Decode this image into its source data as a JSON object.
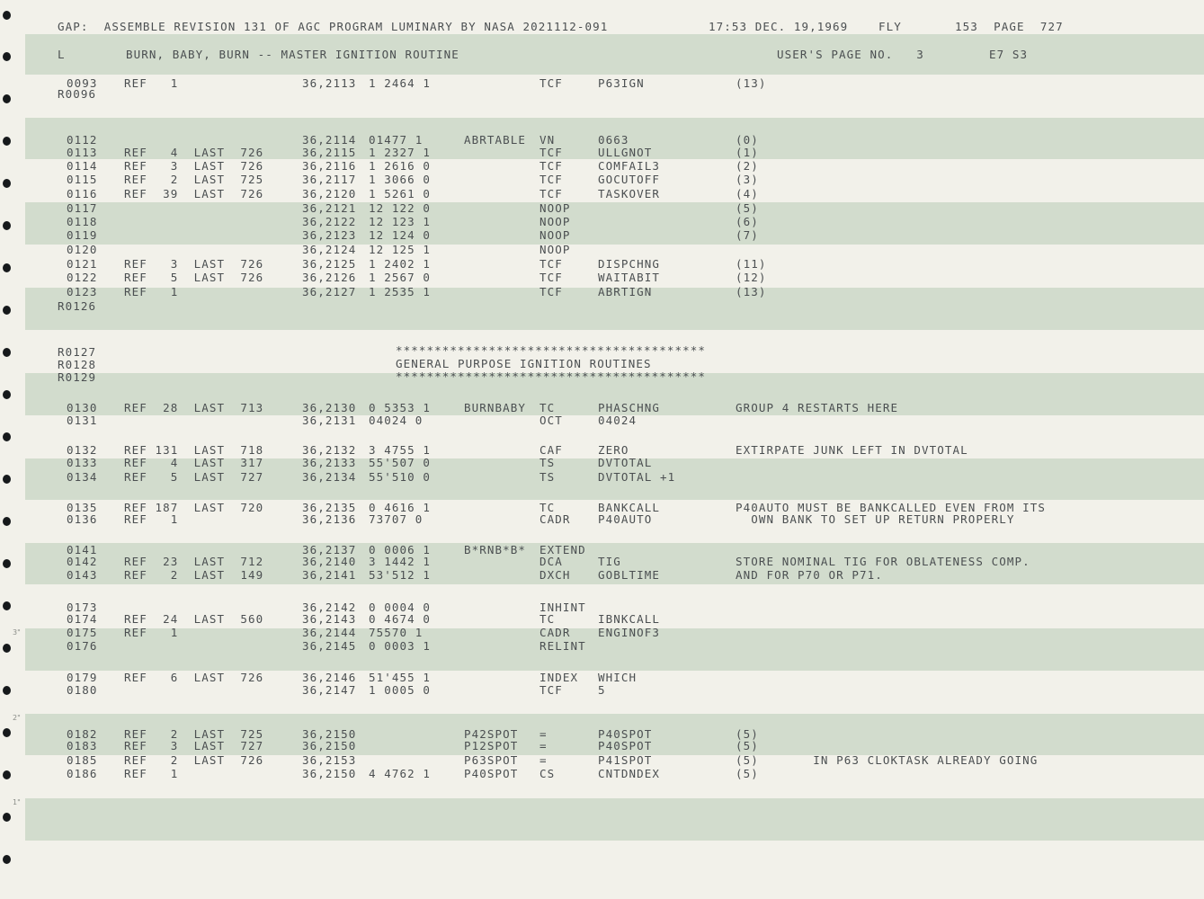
{
  "header": {
    "title": "GAP:  ASSEMBLE REVISION 131 OF AGC PROGRAM LUMINARY BY NASA 2021112-091",
    "timestamp": "17:53 DEC. 19,1969",
    "fly": "FLY",
    "page_info": "153  PAGE  727",
    "log_letter": "L",
    "routine_title": "BURN, BABY, BURN -- MASTER IGNITION ROUTINE",
    "user_page": "USER'S PAGE NO.   3",
    "code": "E7 S3"
  },
  "banner": {
    "stars": "****************************************",
    "title": "GENERAL PURPOSE IGNITION ROUTINES"
  },
  "margin_marks": [
    "3\"",
    "2\"",
    "1\""
  ],
  "listing": [
    {
      "seq": "0093",
      "ref": "REF   1",
      "addr": "36,2113",
      "word": "1 2464 1",
      "label": "",
      "op": "TCF",
      "operand": "P63IGN",
      "comment": "(13)"
    },
    {
      "seq": "R0096",
      "ref": "",
      "addr": "",
      "word": "",
      "label": "",
      "op": "",
      "operand": "",
      "comment": ""
    },
    {
      "seq": "0112",
      "ref": "",
      "addr": "36,2114",
      "word": "01477 1",
      "label": "ABRTABLE",
      "op": "VN",
      "operand": "0663",
      "comment": "(0)"
    },
    {
      "seq": "0113",
      "ref": "REF   4  LAST  726",
      "addr": "36,2115",
      "word": "1 2327 1",
      "label": "",
      "op": "TCF",
      "operand": "ULLGNOT",
      "comment": "(1)"
    },
    {
      "seq": "0114",
      "ref": "REF   3  LAST  726",
      "addr": "36,2116",
      "word": "1 2616 0",
      "label": "",
      "op": "TCF",
      "operand": "COMFAIL3",
      "comment": "(2)"
    },
    {
      "seq": "0115",
      "ref": "REF   2  LAST  725",
      "addr": "36,2117",
      "word": "1 3066 0",
      "label": "",
      "op": "TCF",
      "operand": "GOCUTOFF",
      "comment": "(3)"
    },
    {
      "seq": "0116",
      "ref": "REF  39  LAST  726",
      "addr": "36,2120",
      "word": "1 5261 0",
      "label": "",
      "op": "TCF",
      "operand": "TASKOVER",
      "comment": "(4)"
    },
    {
      "seq": "0117",
      "ref": "",
      "addr": "36,2121",
      "word": "12 122 0",
      "label": "",
      "op": "NOOP",
      "operand": "",
      "comment": "(5)"
    },
    {
      "seq": "0118",
      "ref": "",
      "addr": "36,2122",
      "word": "12 123 1",
      "label": "",
      "op": "NOOP",
      "operand": "",
      "comment": "(6)"
    },
    {
      "seq": "0119",
      "ref": "",
      "addr": "36,2123",
      "word": "12 124 0",
      "label": "",
      "op": "NOOP",
      "operand": "",
      "comment": "(7)"
    },
    {
      "seq": "0120",
      "ref": "",
      "addr": "36,2124",
      "word": "12 125 1",
      "label": "",
      "op": "NOOP",
      "operand": "",
      "comment": ""
    },
    {
      "seq": "0121",
      "ref": "REF   3  LAST  726",
      "addr": "36,2125",
      "word": "1 2402 1",
      "label": "",
      "op": "TCF",
      "operand": "DISPCHNG",
      "comment": "(11)"
    },
    {
      "seq": "0122",
      "ref": "REF   5  LAST  726",
      "addr": "36,2126",
      "word": "1 2567 0",
      "label": "",
      "op": "TCF",
      "operand": "WAITABIT",
      "comment": "(12)"
    },
    {
      "seq": "0123",
      "ref": "REF   1",
      "addr": "36,2127",
      "word": "1 2535 1",
      "label": "",
      "op": "TCF",
      "operand": "ABRTIGN",
      "comment": "(13)"
    },
    {
      "seq": "R0126",
      "ref": "",
      "addr": "",
      "word": "",
      "label": "",
      "op": "",
      "operand": "",
      "comment": ""
    },
    {
      "seq": "R0127",
      "ref": "",
      "addr": "",
      "word": "",
      "label": "",
      "op": "",
      "operand": "",
      "comment": ""
    },
    {
      "seq": "R0128",
      "ref": "",
      "addr": "",
      "word": "",
      "label": "",
      "op": "",
      "operand": "",
      "comment": ""
    },
    {
      "seq": "R0129",
      "ref": "",
      "addr": "",
      "word": "",
      "label": "",
      "op": "",
      "operand": "",
      "comment": ""
    },
    {
      "seq": "0130",
      "ref": "REF  28  LAST  713",
      "addr": "36,2130",
      "word": "0 5353 1",
      "label": "BURNBABY",
      "op": "TC",
      "operand": "PHASCHNG",
      "comment": "GROUP 4 RESTARTS HERE"
    },
    {
      "seq": "0131",
      "ref": "",
      "addr": "36,2131",
      "word": "04024 0",
      "label": "",
      "op": "OCT",
      "operand": "04024",
      "comment": ""
    },
    {
      "seq": "0132",
      "ref": "REF 131  LAST  718",
      "addr": "36,2132",
      "word": "3 4755 1",
      "label": "",
      "op": "CAF",
      "operand": "ZERO",
      "comment": "EXTIRPATE JUNK LEFT IN DVTOTAL"
    },
    {
      "seq": "0133",
      "ref": "REF   4  LAST  317",
      "addr": "36,2133",
      "word": "55'507 0",
      "label": "",
      "op": "TS",
      "operand": "DVTOTAL",
      "comment": ""
    },
    {
      "seq": "0134",
      "ref": "REF   5  LAST  727",
      "addr": "36,2134",
      "word": "55'510 0",
      "label": "",
      "op": "TS",
      "operand": "DVTOTAL +1",
      "comment": ""
    },
    {
      "seq": "0135",
      "ref": "REF 187  LAST  720",
      "addr": "36,2135",
      "word": "0 4616 1",
      "label": "",
      "op": "TC",
      "operand": "BANKCALL",
      "comment": "P40AUTO MUST BE BANKCALLED EVEN FROM ITS"
    },
    {
      "seq": "0136",
      "ref": "REF   1",
      "addr": "36,2136",
      "word": "73707 0",
      "label": "",
      "op": "CADR",
      "operand": "P40AUTO",
      "comment": "  OWN BANK TO SET UP RETURN PROPERLY"
    },
    {
      "seq": "0141",
      "ref": "",
      "addr": "36,2137",
      "word": "0 0006 1",
      "label": "B*RNB*B*",
      "op": "EXTEND",
      "operand": "",
      "comment": ""
    },
    {
      "seq": "0142",
      "ref": "REF  23  LAST  712",
      "addr": "36,2140",
      "word": "3 1442 1",
      "label": "",
      "op": "DCA",
      "operand": "TIG",
      "comment": "STORE NOMINAL TIG FOR OBLATENESS COMP."
    },
    {
      "seq": "0143",
      "ref": "REF   2  LAST  149",
      "addr": "36,2141",
      "word": "53'512 1",
      "label": "",
      "op": "DXCH",
      "operand": "GOBLTIME",
      "comment": "AND FOR P70 OR P71."
    },
    {
      "seq": "0173",
      "ref": "",
      "addr": "36,2142",
      "word": "0 0004 0",
      "label": "",
      "op": "INHINT",
      "operand": "",
      "comment": ""
    },
    {
      "seq": "0174",
      "ref": "REF  24  LAST  560",
      "addr": "36,2143",
      "word": "0 4674 0",
      "label": "",
      "op": "TC",
      "operand": "IBNKCALL",
      "comment": ""
    },
    {
      "seq": "0175",
      "ref": "REF   1",
      "addr": "36,2144",
      "word": "75570 1",
      "label": "",
      "op": "CADR",
      "operand": "ENGINOF3",
      "comment": ""
    },
    {
      "seq": "0176",
      "ref": "",
      "addr": "36,2145",
      "word": "0 0003 1",
      "label": "",
      "op": "RELINT",
      "operand": "",
      "comment": ""
    },
    {
      "seq": "0179",
      "ref": "REF   6  LAST  726",
      "addr": "36,2146",
      "word": "51'455 1",
      "label": "",
      "op": "INDEX",
      "operand": "WHICH",
      "comment": ""
    },
    {
      "seq": "0180",
      "ref": "",
      "addr": "36,2147",
      "word": "1 0005 0",
      "label": "",
      "op": "TCF",
      "operand": "5",
      "comment": ""
    },
    {
      "seq": "0182",
      "ref": "REF   2  LAST  725",
      "addr": "36,2150",
      "word": "",
      "label": "P42SPOT",
      "op": "=",
      "operand": "P40SPOT",
      "comment": "(5)"
    },
    {
      "seq": "0183",
      "ref": "REF   3  LAST  727",
      "addr": "36,2150",
      "word": "",
      "label": "P12SPOT",
      "op": "=",
      "operand": "P40SPOT",
      "comment": "(5)"
    },
    {
      "seq": "0185",
      "ref": "REF   2  LAST  726",
      "addr": "36,2153",
      "word": "",
      "label": "P63SPOT",
      "op": "=",
      "operand": "P41SPOT",
      "comment": "(5)       IN P63 CLOKTASK ALREADY GOING"
    },
    {
      "seq": "0186",
      "ref": "REF   1",
      "addr": "36,2150",
      "word": "4 4762 1",
      "label": "P40SPOT",
      "op": "CS",
      "operand": "CNTDNDEX",
      "comment": "(5)"
    }
  ]
}
